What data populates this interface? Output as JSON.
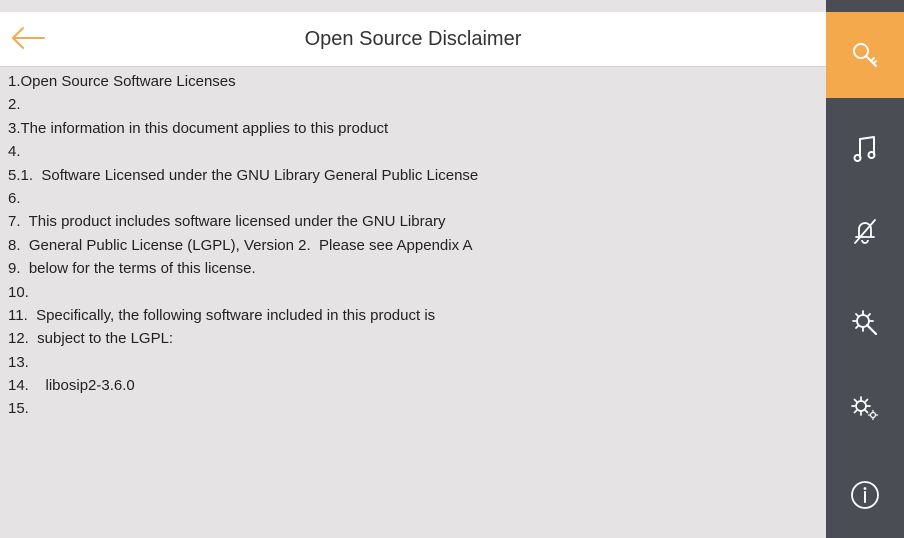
{
  "header": {
    "title": "Open Source Disclaimer"
  },
  "document": {
    "lines": [
      "1.Open Source Software Licenses",
      "2.",
      "3.The information in this document applies to this product",
      "4.",
      "5.1.  Software Licensed under the GNU Library General Public License",
      "6.",
      "7.  This product includes software licensed under the GNU Library",
      "8.  General Public License (LGPL), Version 2.  Please see Appendix A",
      "9.  below for the terms of this license.",
      "10.",
      "11.  Specifically, the following software included in this product is",
      "12.  subject to the LGPL:",
      "13.",
      "14.    libosip2-3.6.0",
      "15."
    ]
  },
  "sidebar": {
    "items": [
      {
        "icon": "key-search-icon",
        "active": true
      },
      {
        "icon": "music-note-icon",
        "active": false
      },
      {
        "icon": "bell-muted-icon",
        "active": false
      },
      {
        "icon": "settings-search-icon",
        "active": false
      },
      {
        "icon": "gears-icon",
        "active": false
      },
      {
        "icon": "info-icon",
        "active": false
      }
    ]
  },
  "colors": {
    "accent": "#f3a94c",
    "sidebar": "#4a4d54",
    "background": "#e6e3e4"
  }
}
